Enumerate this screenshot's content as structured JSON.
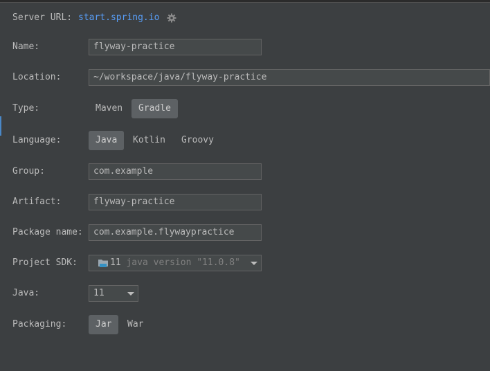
{
  "server": {
    "label": "Server URL:",
    "url": "start.spring.io",
    "icon": "gear-icon"
  },
  "name": {
    "label": "Name:",
    "value": "flyway-practice"
  },
  "location": {
    "label": "Location:",
    "value": "~/workspace/java/flyway-practice"
  },
  "type": {
    "label": "Type:",
    "options": [
      "Maven",
      "Gradle"
    ],
    "selected": "Gradle"
  },
  "language": {
    "label": "Language:",
    "options": [
      "Java",
      "Kotlin",
      "Groovy"
    ],
    "selected": "Java"
  },
  "group": {
    "label": "Group:",
    "value": "com.example"
  },
  "artifact": {
    "label": "Artifact:",
    "value": "flyway-practice"
  },
  "package_name": {
    "label": "Package name:",
    "value": "com.example.flywaypractice"
  },
  "project_sdk": {
    "label": "Project SDK:",
    "value": "11",
    "version": "java version \"11.0.8\"",
    "icon": "folder-icon"
  },
  "java": {
    "label": "Java:",
    "value": "11"
  },
  "packaging": {
    "label": "Packaging:",
    "options": [
      "Jar",
      "War"
    ],
    "selected": "Jar"
  },
  "colors": {
    "background": "#3c3f41",
    "link": "#589df6",
    "selected_segment": "#5d6164"
  }
}
